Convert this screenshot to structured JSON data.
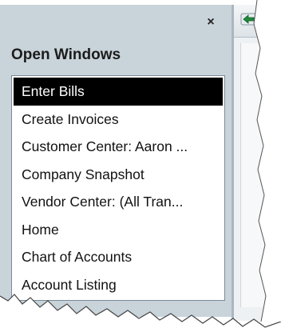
{
  "panel": {
    "title": "Open Windows",
    "close_glyph": "×",
    "items": [
      {
        "label": "Enter Bills",
        "selected": true
      },
      {
        "label": "Create Invoices",
        "selected": false
      },
      {
        "label": "Customer Center: Aaron ...",
        "selected": false
      },
      {
        "label": "Company Snapshot",
        "selected": false
      },
      {
        "label": "Vendor Center: (All Tran...",
        "selected": false
      },
      {
        "label": "Home",
        "selected": false
      },
      {
        "label": "Chart of Accounts",
        "selected": false
      },
      {
        "label": "Account Listing",
        "selected": false
      }
    ]
  },
  "icons": {
    "close": "close-icon",
    "back": "back-arrow-icon"
  },
  "colors": {
    "panel_bg": "#c9d3da",
    "selected_bg": "#000000",
    "selected_fg": "#ffffff"
  }
}
